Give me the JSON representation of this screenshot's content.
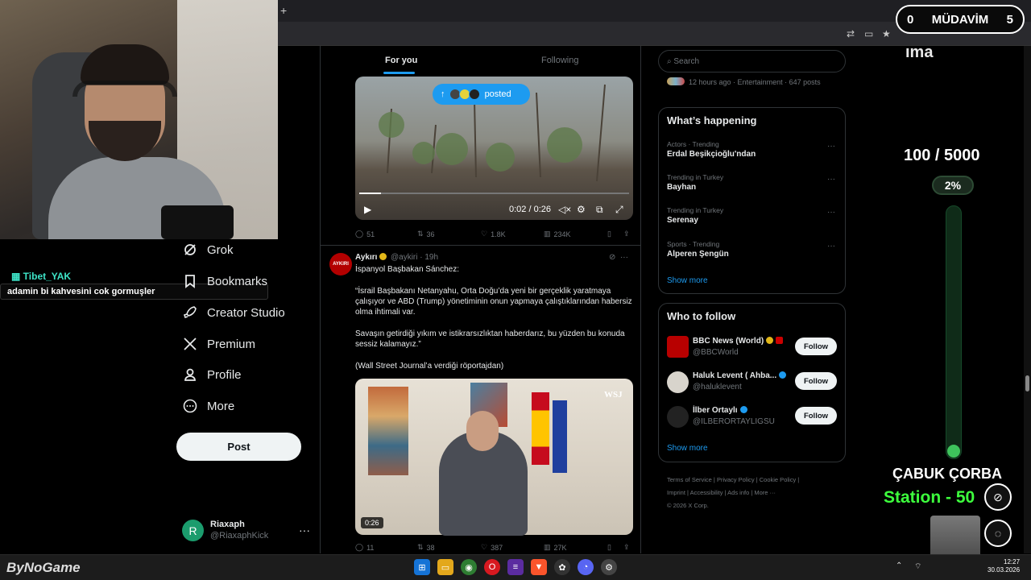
{
  "browser": {
    "new_tab": "+"
  },
  "overlay": {
    "mudavim": {
      "left": "0",
      "label": "MÜDAVİM",
      "right": "5"
    },
    "ticker": "ıma",
    "goal": {
      "text": "100 / 5000",
      "percent": "2%",
      "fraction": 0.02
    },
    "cabuk": "ÇABUK ÇORBA",
    "station": "Station - 50",
    "chat": {
      "user": "Tibet_YAK",
      "message": "adamin bi kahvesini cok gormuşler"
    },
    "brand": "ByNoGame"
  },
  "nav": {
    "items": [
      {
        "label": "Grok"
      },
      {
        "label": "Bookmarks"
      },
      {
        "label": "Creator Studio"
      },
      {
        "label": "Premium"
      },
      {
        "label": "Profile"
      },
      {
        "label": "More"
      }
    ],
    "post_button": "Post",
    "account": {
      "initial": "R",
      "name": "Riaxaph",
      "handle": "@RiaxaphKick",
      "more": "···"
    }
  },
  "timeline": {
    "tabs": [
      "For you",
      "Following"
    ],
    "posted_pill": "posted",
    "video1": {
      "time": "0:02 / 0:26",
      "progress": 0.08
    },
    "post1_stats": {
      "replies": "51",
      "reposts": "36",
      "likes": "1.8K",
      "views": "234K"
    },
    "post2": {
      "avatar_text": "AYKIRI",
      "name": "Aykırı",
      "meta": "@aykiri · 19h",
      "lines": [
        "İspanyol Başbakan Sánchez:",
        "“İsrail Başbakanı Netanyahu, Orta Doğu’da yeni bir gerçeklik yaratmaya çalışıyor ve ABD (Trump) yönetiminin onun yapmaya çalıştıklarından habersiz olma ihtimali var.",
        "Savaşın getirdiği yıkım ve istikrarsızlıktan haberdarız, bu yüzden bu konuda sessiz kalamayız.”",
        "(Wall Street Journal’a verdiği röportajdan)"
      ],
      "video_label": "WSJ",
      "video_duration": "0:26",
      "stats": {
        "replies": "11",
        "reposts": "38",
        "likes": "387",
        "views": "27K"
      }
    }
  },
  "sidebar": {
    "search_placeholder": "Search",
    "entertainment_line": "12 hours ago · Entertainment · 647 posts",
    "happening": {
      "title": "What’s happening",
      "trends": [
        {
          "context": "Actors · Trending",
          "name": "Erdal Beşikçioğlu'ndan"
        },
        {
          "context": "Trending in Turkey",
          "name": "Bayhan"
        },
        {
          "context": "Trending in Turkey",
          "name": "Serenay"
        },
        {
          "context": "Sports · Trending",
          "name": "Alperen Şengün"
        }
      ],
      "show_more": "Show more"
    },
    "who_to_follow": {
      "title": "Who to follow",
      "accounts": [
        {
          "name": "BBC News (World)",
          "handle": "@BBCWorld",
          "button": "Follow"
        },
        {
          "name": "Haluk Levent ( Ahba...",
          "handle": "@haluklevent",
          "button": "Follow"
        },
        {
          "name": "İlber Ortaylı",
          "handle": "@ILBERORTAYLIGSU",
          "button": "Follow"
        }
      ],
      "show_more": "Show more"
    },
    "footer": {
      "line1": "Terms of Service  |  Privacy Policy  |  Cookie Policy  |",
      "line2": "Imprint  |  Accessibility  |  Ads info  |  More ···",
      "line3": "© 2026 X Corp."
    }
  },
  "taskbar": {
    "time": "12:27",
    "date": "30.03.2026"
  },
  "colors": {
    "accent": "#1d9bf0",
    "background": "#000000",
    "goal_green": "#3ec35c",
    "station_green": "#3dff3d"
  }
}
